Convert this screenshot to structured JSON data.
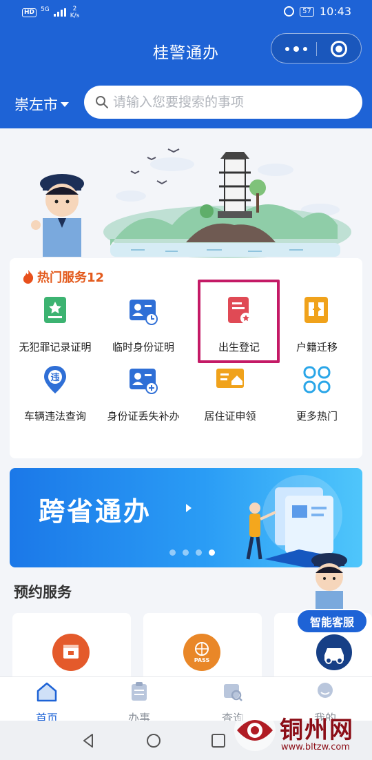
{
  "status_bar": {
    "hd": "HD",
    "network": "5G",
    "speed_value": "2",
    "speed_unit": "K/s",
    "battery": "57",
    "time": "10:43"
  },
  "header": {
    "title": "桂警通办",
    "city": "崇左市",
    "search_placeholder": "请输入您要搜索的事项"
  },
  "hot_services": {
    "title": "热门服务12",
    "items": [
      {
        "label": "无犯罪记录证明",
        "icon": "certificate-icon",
        "color": "#3cb371"
      },
      {
        "label": "临时身份证明",
        "icon": "temp-id-icon",
        "color": "#2f6fd6"
      },
      {
        "label": "出生登记",
        "icon": "birth-registration-icon",
        "color": "#e04a55"
      },
      {
        "label": "户籍迁移",
        "icon": "household-transfer-icon",
        "color": "#f0a21b"
      },
      {
        "label": "车辆违法查询",
        "icon": "traffic-violation-icon",
        "color": "#2f6fd6"
      },
      {
        "label": "身份证丢失补办",
        "icon": "id-card-reissue-icon",
        "color": "#2f6fd6"
      },
      {
        "label": "居住证申领",
        "icon": "residence-permit-icon",
        "color": "#f0a21b"
      },
      {
        "label": "更多热门",
        "icon": "more-icon",
        "color": "#2aa6e8"
      }
    ]
  },
  "promo": {
    "title": "跨省通办",
    "page_index": 4,
    "page_count": 4
  },
  "appointments": {
    "title": "预约服务",
    "badge_pass": "PASS"
  },
  "customer_service": {
    "label": "智能客服"
  },
  "tabbar": {
    "items": [
      {
        "label": "首页",
        "active": true
      },
      {
        "label": "办事",
        "active": false
      },
      {
        "label": "查询",
        "active": false
      },
      {
        "label": "我的",
        "active": false
      }
    ]
  },
  "watermark": {
    "name": "铜州网",
    "url": "www.bltzw.com"
  },
  "colors": {
    "primary": "#1e63d6",
    "hot": "#e35a1c",
    "highlight": "#c41a66"
  }
}
